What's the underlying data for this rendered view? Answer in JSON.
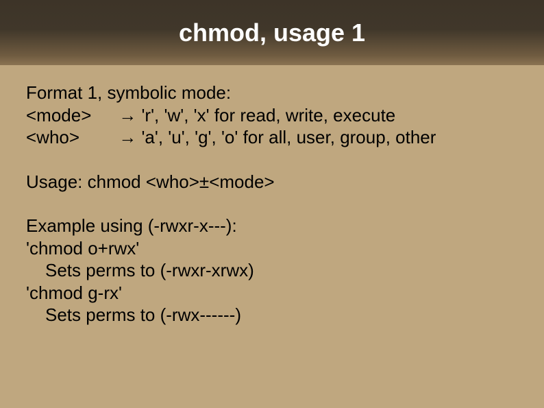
{
  "title": "chmod, usage 1",
  "line_format": "Format 1, symbolic mode:",
  "mode_key": "<mode>",
  "mode_desc": "→ 'r', 'w', 'x' for read, write, execute",
  "who_key": "<who>",
  "who_desc": "→ 'a', 'u', 'g', 'o' for all, user, group, other",
  "usage_line": "Usage: chmod <who>±<mode>",
  "example_heading": "Example using (-rwxr-x---):",
  "ex1_cmd": "'chmod o+rwx'",
  "ex1_result": "Sets perms to (-rwxr-xrwx)",
  "ex2_cmd": "'chmod g-rx'",
  "ex2_result": "Sets perms to (-rwx------)"
}
